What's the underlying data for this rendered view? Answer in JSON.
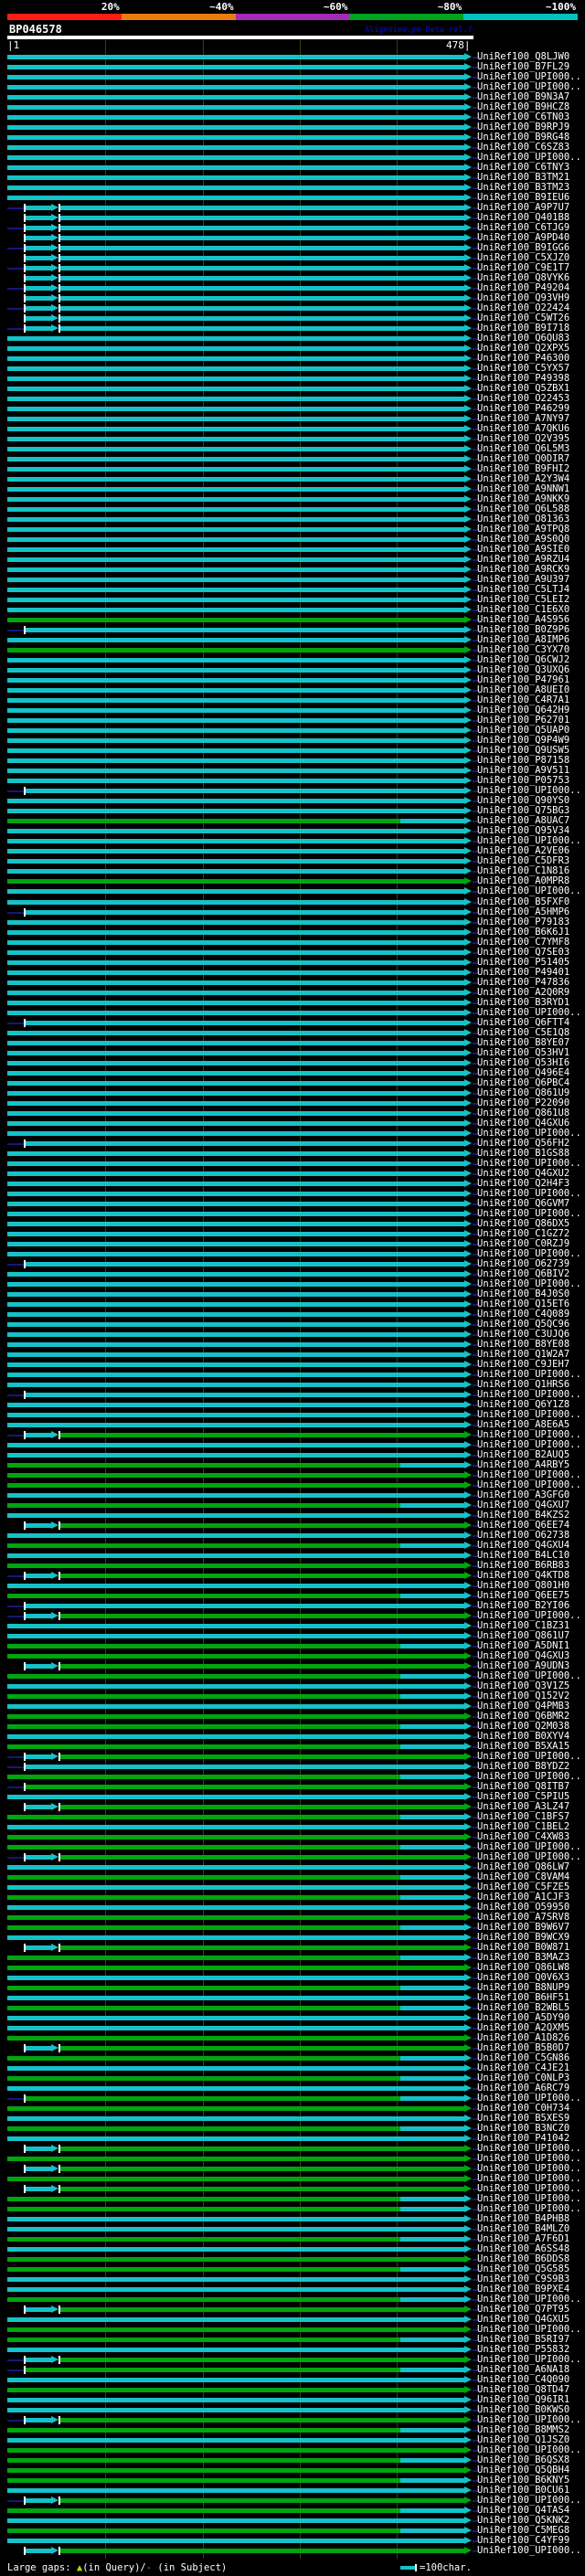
{
  "chart_data": {
    "type": "bar",
    "orientation": "horizontal",
    "title": "BP046578",
    "watermark": "AlignView.pm Beta rel.7",
    "query_range": [
      1,
      478
    ],
    "ruler_left_label": "|1",
    "ruler_right_label": "478|",
    "identity_scale": {
      "labels": [
        "20%",
        "~40%",
        "~60%",
        "~80%",
        "~100%"
      ],
      "colors": [
        "#ff1c10",
        "#e87c10",
        "#a32bb5",
        "#00a41c",
        "#00c2c2"
      ]
    },
    "legend": {
      "large_gaps": "Large gaps:",
      "query_gap_triangle": "▲",
      "query_marker": "(in Query)/",
      "subject_gap_dash": "-",
      "subject_marker": " (in Subject)",
      "scale_marker": "=100char."
    },
    "colors": {
      "cyan_bar": "#15c2c8",
      "green_bar": "#00a510",
      "navy_line": "#16167a",
      "gridline": "#3c3c12",
      "gap_triangle_yellow": "#cccc00"
    },
    "color_key": {
      "c": "cyan high identity",
      "g": "green lower identity",
      "m": "mixed green then cyan"
    },
    "row_label_prefix": "UniRef100_",
    "rows": [
      [
        "Q8LJW0",
        "c",
        0
      ],
      [
        "B7FL29",
        "c",
        0
      ],
      [
        "UPI000..",
        "c",
        0
      ],
      [
        "UPI000..",
        "c",
        0
      ],
      [
        "B9N3A7",
        "c",
        0
      ],
      [
        "B9HCZ8",
        "c",
        0
      ],
      [
        "C6TN03",
        "c",
        0
      ],
      [
        "B9RPJ9",
        "c",
        0
      ],
      [
        "B9RG48",
        "c",
        0
      ],
      [
        "C6SZ83",
        "c",
        0
      ],
      [
        "UPI000..",
        "c",
        0
      ],
      [
        "C6TNY3",
        "c",
        0
      ],
      [
        "B3TM21",
        "c",
        0
      ],
      [
        "B3TM23",
        "c",
        0
      ],
      [
        "B9IEU6",
        "c",
        0
      ],
      [
        "A9P7U7",
        "c",
        1
      ],
      [
        "Q401B8",
        "c",
        1
      ],
      [
        "C6TJG9",
        "c",
        1
      ],
      [
        "A9PD40",
        "c",
        1
      ],
      [
        "B9IGG6",
        "c",
        1
      ],
      [
        "C5XJZ0",
        "c",
        1
      ],
      [
        "C9E1T7",
        "c",
        1
      ],
      [
        "Q8VYK6",
        "c",
        1
      ],
      [
        "P49204",
        "c",
        1
      ],
      [
        "Q93VH9",
        "c",
        1
      ],
      [
        "O22424",
        "c",
        1
      ],
      [
        "C5WT26",
        "c",
        1
      ],
      [
        "B9I718",
        "c",
        1
      ],
      [
        "Q6QU83",
        "c",
        0
      ],
      [
        "Q2XPX5",
        "c",
        0
      ],
      [
        "P46300",
        "c",
        0
      ],
      [
        "C5YX57",
        "c",
        0
      ],
      [
        "P49398",
        "c",
        0
      ],
      [
        "Q5ZBX1",
        "c",
        0
      ],
      [
        "O22453",
        "c",
        0
      ],
      [
        "P46299",
        "c",
        0
      ],
      [
        "A7NY97",
        "c",
        0
      ],
      [
        "A7QKU6",
        "c",
        0
      ],
      [
        "Q2V395",
        "c",
        0
      ],
      [
        "Q6L5M3",
        "c",
        0
      ],
      [
        "Q0DIR7",
        "c",
        0
      ],
      [
        "B9FHI2",
        "c",
        0
      ],
      [
        "A2Y3W4",
        "c",
        0
      ],
      [
        "A9NNW1",
        "c",
        0
      ],
      [
        "A9NKK9",
        "c",
        0
      ],
      [
        "Q6L588",
        "c",
        0
      ],
      [
        "O81363",
        "c",
        0
      ],
      [
        "A9TPQ8",
        "c",
        0
      ],
      [
        "A9S0Q0",
        "c",
        0
      ],
      [
        "A9SIE0",
        "c",
        0
      ],
      [
        "A9RZU4",
        "c",
        0
      ],
      [
        "A9RCK9",
        "c",
        0
      ],
      [
        "A9U397",
        "c",
        0
      ],
      [
        "C5LTJ4",
        "c",
        0
      ],
      [
        "C5LEI2",
        "c",
        0
      ],
      [
        "C1E6X0",
        "c",
        0
      ],
      [
        "A4S956",
        "g",
        0
      ],
      [
        "B0Z9P6",
        "c",
        2
      ],
      [
        "A8IMP6",
        "c",
        0
      ],
      [
        "C3YX70",
        "g",
        0
      ],
      [
        "Q6CWJ2",
        "c",
        0
      ],
      [
        "Q3UXQ6",
        "c",
        0
      ],
      [
        "P47961",
        "c",
        0
      ],
      [
        "A8UEI0",
        "c",
        0
      ],
      [
        "C4R7A1",
        "c",
        0
      ],
      [
        "Q642H9",
        "c",
        0
      ],
      [
        "P62701",
        "c",
        0
      ],
      [
        "Q5UAP0",
        "c",
        0
      ],
      [
        "Q9P4W9",
        "c",
        0
      ],
      [
        "Q9USW5",
        "c",
        0
      ],
      [
        "P87158",
        "c",
        0
      ],
      [
        "A9V511",
        "c",
        0
      ],
      [
        "P05753",
        "c",
        0
      ],
      [
        "UPI000..",
        "c",
        2
      ],
      [
        "Q90YS0",
        "c",
        0
      ],
      [
        "Q75BG3",
        "c",
        0
      ],
      [
        "A8UAC7",
        "m",
        0
      ],
      [
        "Q95V34",
        "c",
        0
      ],
      [
        "UPI000..",
        "c",
        0
      ],
      [
        "A2VE06",
        "c",
        0
      ],
      [
        "C5DFR3",
        "c",
        0
      ],
      [
        "C1N816",
        "c",
        0
      ],
      [
        "A0MPR8",
        "g",
        0
      ],
      [
        "UPI000..",
        "c",
        0
      ],
      [
        "B5FXF0",
        "c",
        0
      ],
      [
        "A5HMP6",
        "c",
        2
      ],
      [
        "P79183",
        "c",
        0
      ],
      [
        "B6K6J1",
        "c",
        0
      ],
      [
        "C7YMF8",
        "c",
        0
      ],
      [
        "Q7SE03",
        "c",
        0
      ],
      [
        "P51405",
        "c",
        0
      ],
      [
        "P49401",
        "c",
        0
      ],
      [
        "P47836",
        "c",
        0
      ],
      [
        "A2Q0R9",
        "c",
        0
      ],
      [
        "B3RYD1",
        "c",
        0
      ],
      [
        "UPI000..",
        "c",
        0
      ],
      [
        "Q6FTT4",
        "c",
        2
      ],
      [
        "C5E1Q8",
        "c",
        0
      ],
      [
        "B8YE07",
        "c",
        0
      ],
      [
        "Q53HV1",
        "c",
        0
      ],
      [
        "Q53HI6",
        "c",
        0
      ],
      [
        "Q496E4",
        "c",
        0
      ],
      [
        "Q6PBC4",
        "c",
        0
      ],
      [
        "Q861U9",
        "c",
        0
      ],
      [
        "P22090",
        "c",
        0
      ],
      [
        "Q861U8",
        "c",
        0
      ],
      [
        "Q4GXU6",
        "c",
        0
      ],
      [
        "UPI000..",
        "c",
        0
      ],
      [
        "Q56FH2",
        "c",
        2
      ],
      [
        "B1GS88",
        "c",
        0
      ],
      [
        "UPI000..",
        "c",
        0
      ],
      [
        "Q4GXU2",
        "c",
        0
      ],
      [
        "Q2H4F3",
        "c",
        0
      ],
      [
        "UPI000..",
        "c",
        0
      ],
      [
        "Q6GVM7",
        "c",
        0
      ],
      [
        "UPI000..",
        "c",
        0
      ],
      [
        "Q86DX5",
        "c",
        0
      ],
      [
        "C1GZ72",
        "c",
        0
      ],
      [
        "C0RZJ9",
        "c",
        0
      ],
      [
        "UPI000..",
        "c",
        0
      ],
      [
        "O62739",
        "c",
        2
      ],
      [
        "Q6BIV2",
        "c",
        0
      ],
      [
        "UPI000..",
        "c",
        0
      ],
      [
        "B4J0S0",
        "c",
        0
      ],
      [
        "Q15ET6",
        "c",
        0
      ],
      [
        "C4Q089",
        "c",
        0
      ],
      [
        "Q5QC96",
        "c",
        0
      ],
      [
        "C3UJQ6",
        "c",
        0
      ],
      [
        "B8YE08",
        "c",
        0
      ],
      [
        "Q1W2A7",
        "c",
        0
      ],
      [
        "C9JEH7",
        "c",
        0
      ],
      [
        "UPI000..",
        "c",
        0
      ],
      [
        "Q1HRS6",
        "c",
        0
      ],
      [
        "UPI000..",
        "c",
        2
      ],
      [
        "Q6Y1Z8",
        "c",
        0
      ],
      [
        "UPI000..",
        "c",
        0
      ],
      [
        "A8E6A5",
        "c",
        0
      ],
      [
        "UPI000..",
        "g",
        1
      ],
      [
        "UPI000..",
        "c",
        0
      ],
      [
        "B2AUQ5",
        "c",
        0
      ],
      [
        "A4RBY5",
        "m",
        0
      ],
      [
        "UPI000..",
        "g",
        0
      ],
      [
        "UPI000..",
        "g",
        0
      ],
      [
        "A3GFG0",
        "c",
        0
      ],
      [
        "Q4GXU7",
        "m",
        0
      ],
      [
        "B4KZS2",
        "c",
        0
      ],
      [
        "Q6EE74",
        "g",
        1
      ],
      [
        "O62738",
        "c",
        0
      ],
      [
        "Q4GXU4",
        "m",
        0
      ],
      [
        "B4LC10",
        "c",
        0
      ],
      [
        "B6RB83",
        "g",
        0
      ],
      [
        "Q4KTD8",
        "g",
        1
      ],
      [
        "Q801H0",
        "c",
        0
      ],
      [
        "Q6EE75",
        "m",
        0
      ],
      [
        "B2YI06",
        "c",
        2
      ],
      [
        "UPI000..",
        "g",
        1
      ],
      [
        "C1BZ31",
        "c",
        0
      ],
      [
        "Q861U7",
        "c",
        0
      ],
      [
        "A5DNI1",
        "m",
        0
      ],
      [
        "Q4GXU3",
        "g",
        0
      ],
      [
        "A9UDN3",
        "g",
        1
      ],
      [
        "UPI000..",
        "m",
        0
      ],
      [
        "Q3V1Z5",
        "c",
        0
      ],
      [
        "Q152V2",
        "m",
        0
      ],
      [
        "Q4PMB3",
        "c",
        0
      ],
      [
        "Q6BMR2",
        "g",
        0
      ],
      [
        "Q2M038",
        "m",
        0
      ],
      [
        "B0XYV4",
        "c",
        0
      ],
      [
        "B5XA15",
        "m",
        0
      ],
      [
        "UPI000..",
        "g",
        1
      ],
      [
        "B8YDZ2",
        "c",
        2
      ],
      [
        "UPI000..",
        "m",
        0
      ],
      [
        "Q8ITB7",
        "g",
        2
      ],
      [
        "C5PIU5",
        "c",
        0
      ],
      [
        "A3LZ47",
        "g",
        1
      ],
      [
        "C1BFS7",
        "m",
        0
      ],
      [
        "C1BEL2",
        "c",
        0
      ],
      [
        "C4XW83",
        "g",
        0
      ],
      [
        "UPI000..",
        "m",
        0
      ],
      [
        "UPI000..",
        "g",
        1
      ],
      [
        "Q86LW7",
        "c",
        0
      ],
      [
        "C8VAM4",
        "m",
        0
      ],
      [
        "C5FZE5",
        "c",
        0
      ],
      [
        "A1CJF3",
        "m",
        0
      ],
      [
        "O59950",
        "c",
        0
      ],
      [
        "A7SRV8",
        "g",
        0
      ],
      [
        "B9W6V7",
        "m",
        0
      ],
      [
        "B9WCX9",
        "c",
        0
      ],
      [
        "B0W871",
        "g",
        1
      ],
      [
        "B3MAZ3",
        "m",
        0
      ],
      [
        "Q86LW8",
        "g",
        0
      ],
      [
        "Q0V6X3",
        "c",
        0
      ],
      [
        "B8NUP9",
        "m",
        0
      ],
      [
        "B6HF51",
        "c",
        0
      ],
      [
        "B2WBL5",
        "m",
        0
      ],
      [
        "A5DY90",
        "c",
        0
      ],
      [
        "A2QXM5",
        "c",
        0
      ],
      [
        "A1D826",
        "g",
        0
      ],
      [
        "B5B0D7",
        "g",
        1
      ],
      [
        "C5GN86",
        "m",
        0
      ],
      [
        "C4JE21",
        "c",
        0
      ],
      [
        "C0NLP3",
        "m",
        0
      ],
      [
        "A6RC79",
        "c",
        0
      ],
      [
        "UPI000..",
        "m",
        2
      ],
      [
        "C0H734",
        "g",
        0
      ],
      [
        "B5XES9",
        "c",
        0
      ],
      [
        "B3NCZ0",
        "m",
        0
      ],
      [
        "P41042",
        "c",
        0
      ],
      [
        "UPI000..",
        "g",
        1
      ],
      [
        "UPI000..",
        "g",
        0
      ],
      [
        "UPI000..",
        "g",
        1
      ],
      [
        "UPI000..",
        "g",
        0
      ],
      [
        "UPI000..",
        "g",
        1
      ],
      [
        "UPI000..",
        "m",
        0
      ],
      [
        "UPI000..",
        "m",
        0
      ],
      [
        "B4PHB8",
        "c",
        0
      ],
      [
        "B4MLZ0",
        "c",
        0
      ],
      [
        "A7F6D1",
        "m",
        0
      ],
      [
        "A6SS48",
        "c",
        0
      ],
      [
        "B6DDS8",
        "g",
        0
      ],
      [
        "Q5G585",
        "m",
        0
      ],
      [
        "C9S9B3",
        "c",
        0
      ],
      [
        "B9PXE4",
        "c",
        0
      ],
      [
        "UPI000..",
        "m",
        0
      ],
      [
        "Q7PT95",
        "g",
        1
      ],
      [
        "Q4GXU5",
        "c",
        0
      ],
      [
        "UPI000..",
        "g",
        0
      ],
      [
        "B5RI97",
        "m",
        0
      ],
      [
        "P55832",
        "c",
        0
      ],
      [
        "UPI000..",
        "g",
        1
      ],
      [
        "A6NA18",
        "m",
        2
      ],
      [
        "C4Q090",
        "c",
        0
      ],
      [
        "Q8TD47",
        "g",
        0
      ],
      [
        "Q96IR1",
        "c",
        0
      ],
      [
        "B0KWS0",
        "c",
        0
      ],
      [
        "UPI000..",
        "g",
        1
      ],
      [
        "B8MMS2",
        "m",
        0
      ],
      [
        "Q1JSZ0",
        "c",
        0
      ],
      [
        "UPI000..",
        "g",
        0
      ],
      [
        "B6QSX8",
        "m",
        0
      ],
      [
        "Q5QBH4",
        "g",
        0
      ],
      [
        "B6KNY5",
        "m",
        0
      ],
      [
        "B0CU61",
        "c",
        0
      ],
      [
        "UPI000..",
        "g",
        1
      ],
      [
        "Q4TAS4",
        "m",
        0
      ],
      [
        "Q5KNK2",
        "c",
        0
      ],
      [
        "C5MEG8",
        "m",
        0
      ],
      [
        "C4YF99",
        "c",
        0
      ],
      [
        "UPI000..",
        "g",
        1
      ]
    ]
  }
}
